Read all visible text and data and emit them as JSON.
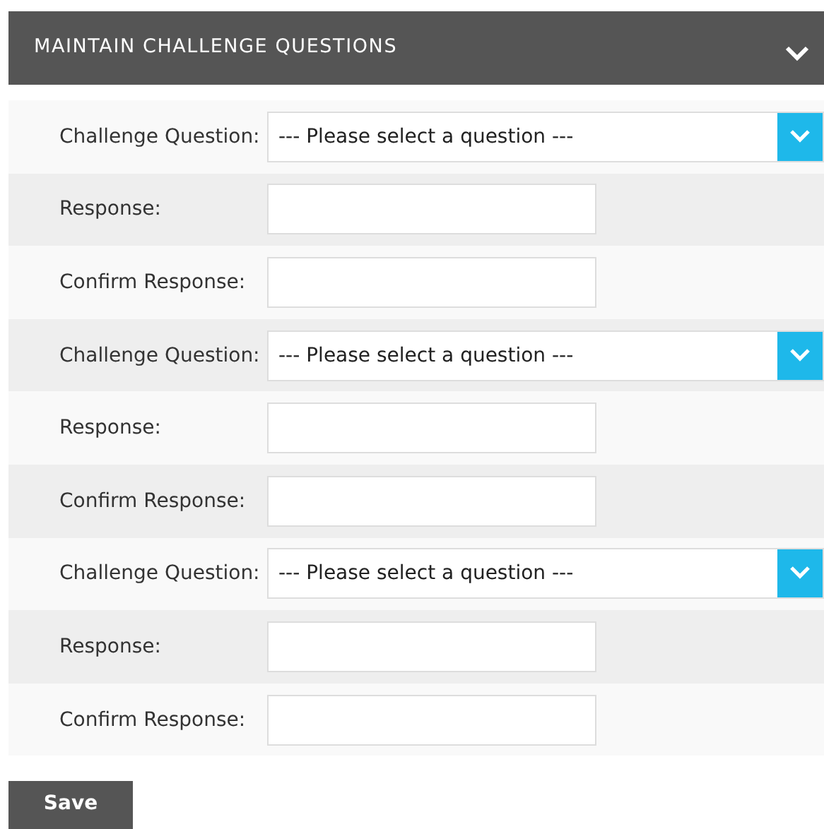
{
  "panel": {
    "title": "MAINTAIN CHALLENGE QUESTIONS",
    "expanded": true
  },
  "rows": [
    {
      "kind": "select",
      "label": "Challenge Question:",
      "value": "--- Please select a question ---"
    },
    {
      "kind": "text",
      "label": "Response:"
    },
    {
      "kind": "text",
      "label": "Confirm Response:"
    },
    {
      "kind": "select",
      "label": "Challenge Question:",
      "value": "--- Please select a question ---"
    },
    {
      "kind": "text",
      "label": "Response:"
    },
    {
      "kind": "text",
      "label": "Confirm Response:"
    },
    {
      "kind": "select",
      "label": "Challenge Question:",
      "value": "--- Please select a question ---"
    },
    {
      "kind": "text",
      "label": "Response:"
    },
    {
      "kind": "text",
      "label": "Confirm Response:"
    }
  ],
  "save_button": "Save"
}
